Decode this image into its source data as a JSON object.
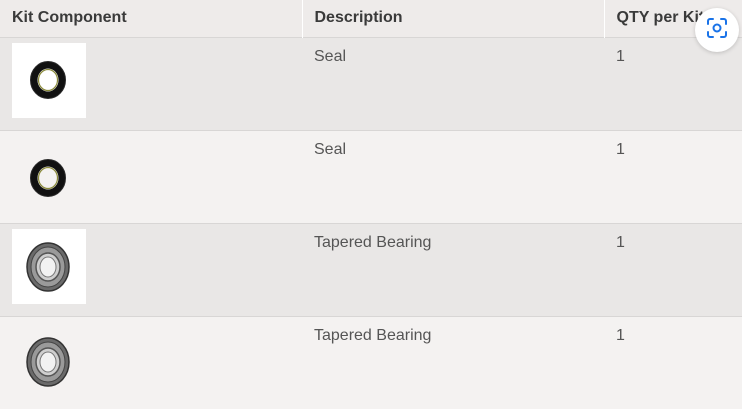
{
  "table": {
    "headers": {
      "component": "Kit Component",
      "description": "Description",
      "qty": "QTY per Kit"
    },
    "rows": [
      {
        "image_icon": "seal-image",
        "description": "Seal",
        "qty": "1"
      },
      {
        "image_icon": "seal-image",
        "description": "Seal",
        "qty": "1"
      },
      {
        "image_icon": "tapered-bearing-image",
        "description": "Tapered Bearing",
        "qty": "1"
      },
      {
        "image_icon": "tapered-bearing-image",
        "description": "Tapered Bearing",
        "qty": "1"
      }
    ]
  },
  "overlay": {
    "icon": "visual-search-icon",
    "accent_color": "#1a73e8"
  },
  "colors": {
    "row_shade": "#e9e7e6",
    "row_plain": "#f4f2f1",
    "header_bg": "#eeebea",
    "text": "#555555"
  }
}
